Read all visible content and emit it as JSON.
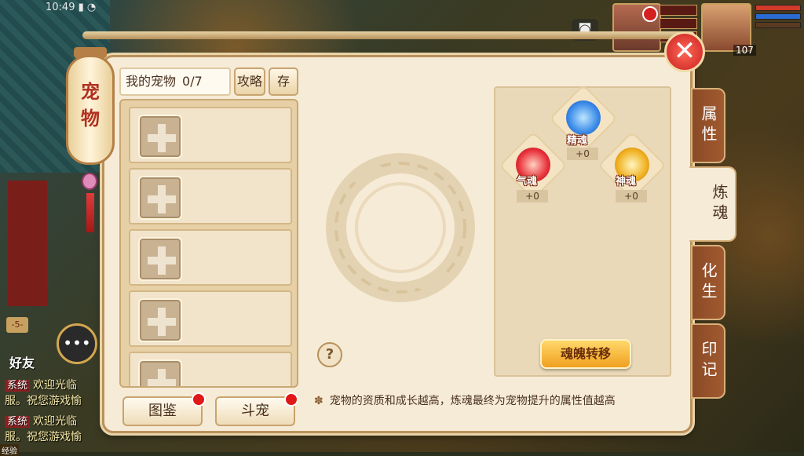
{
  "status": {
    "time": "10:49"
  },
  "hud": {
    "level": "107",
    "camera_icon": "camera-icon"
  },
  "panel": {
    "lantern_title": "宠物",
    "close_icon": "close-icon",
    "list_header": {
      "label": "我的宠物",
      "count": "0/7"
    },
    "strategy_btn": "攻略",
    "store_btn": "存",
    "slot_count": 5,
    "bottom_buttons": {
      "atlas": "图鉴",
      "battle": "斗宠"
    }
  },
  "soul": {
    "gems": [
      {
        "name": "精魂",
        "value": "+0",
        "color": "#3a8ae8"
      },
      {
        "name": "气魂",
        "value": "+0",
        "color": "#e8303a"
      },
      {
        "name": "神魂",
        "value": "+0",
        "color": "#f0b020"
      }
    ],
    "transfer_btn": "魂魄转移",
    "help_btn": "?"
  },
  "hint": "宠物的资质和成长越高，炼魂最终为宠物提升的属性值越高",
  "tabs": [
    "属性",
    "炼魂",
    "化生",
    "印记"
  ],
  "active_tab": "炼魂",
  "chat": {
    "level_badge": "-5-",
    "friends_label": "好友",
    "lines": [
      {
        "tag": "系统",
        "text": "欢迎光临"
      },
      {
        "tag": "",
        "text": "服。祝您游戏愉"
      },
      {
        "tag": "系统",
        "text": "欢迎光临"
      },
      {
        "tag": "",
        "text": "服。祝您游戏愉"
      }
    ],
    "exp_label": "经验"
  }
}
